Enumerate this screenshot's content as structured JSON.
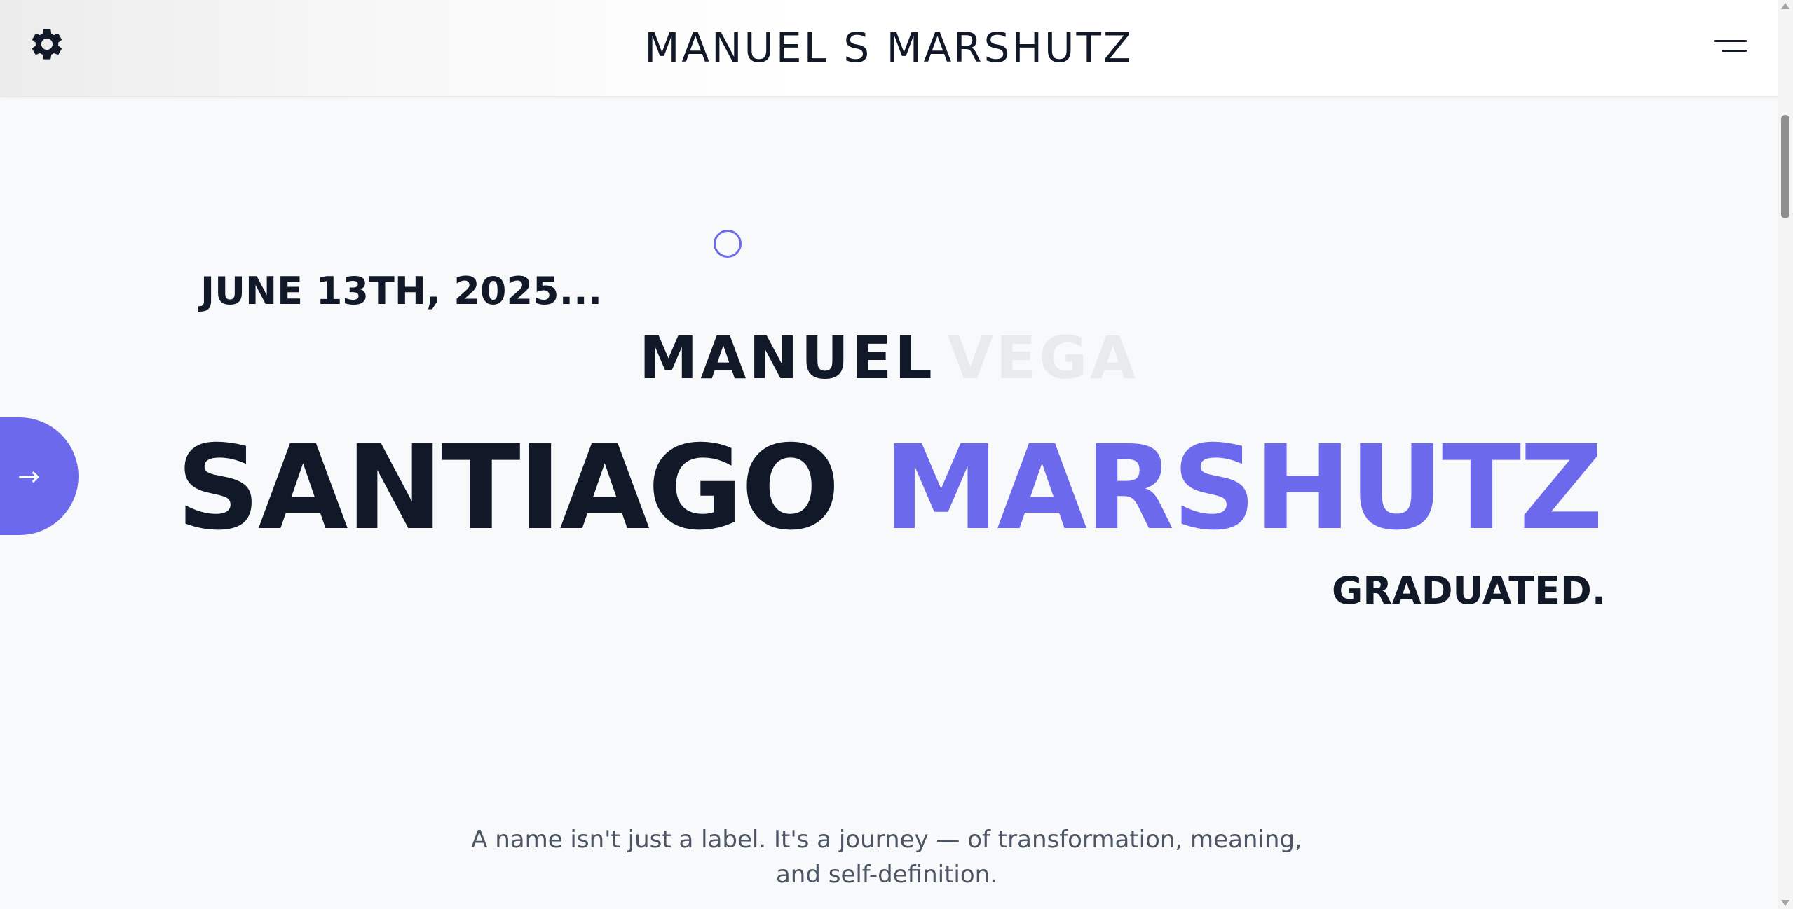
{
  "header": {
    "title": "MANUEL S MARSHUTZ",
    "settings_icon": "gear-icon",
    "menu_icon": "hamburger-menu-icon"
  },
  "hero": {
    "date": "JUNE 13TH, 2025...",
    "first_name": "MANUEL",
    "old_surname": "VEGA",
    "middle_name": "SANTIAGO",
    "last_name": "MARSHUTZ",
    "status": "GRADUATED.",
    "side_button_icon": "right-arrow-icon",
    "side_button_glyph": "→"
  },
  "intro": {
    "tagline": "A name isn't just a label. It's a journey — of transformation, meaning, and self-definition."
  },
  "colors": {
    "accent": "#6c69ed",
    "text_dark": "#111827",
    "text_faded": "#e9eaeb",
    "text_muted": "#4b5563",
    "background": "#f8f9fb"
  }
}
